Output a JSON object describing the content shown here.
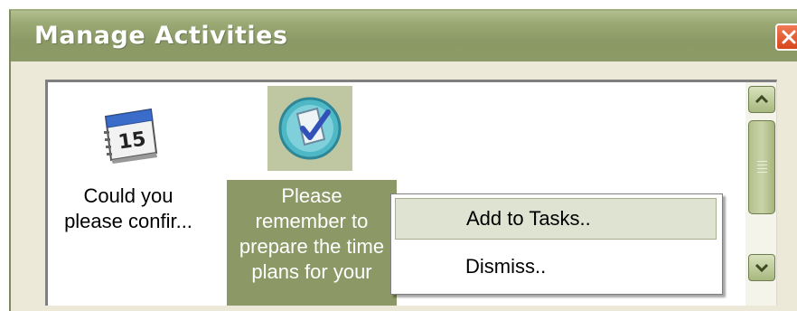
{
  "window": {
    "title": "Manage Activities"
  },
  "icons": {
    "close": "close-x-icon",
    "calendar": "calendar-icon",
    "task": "task-check-icon"
  },
  "activities": [
    {
      "label_line1": "Could you",
      "label_line2": "please confir...",
      "calendar_day": "15"
    },
    {
      "label_line1": "Please",
      "label_line2": "remember to",
      "label_line3": "prepare the time",
      "label_line4": "plans for your"
    }
  ],
  "context_menu": {
    "items": [
      "Add to Tasks..",
      "Dismiss.."
    ]
  },
  "colors": {
    "titlebar": "#8b9966",
    "selection": "#8c9866",
    "menu_highlight": "#dee3d2",
    "close": "#d6471d"
  }
}
